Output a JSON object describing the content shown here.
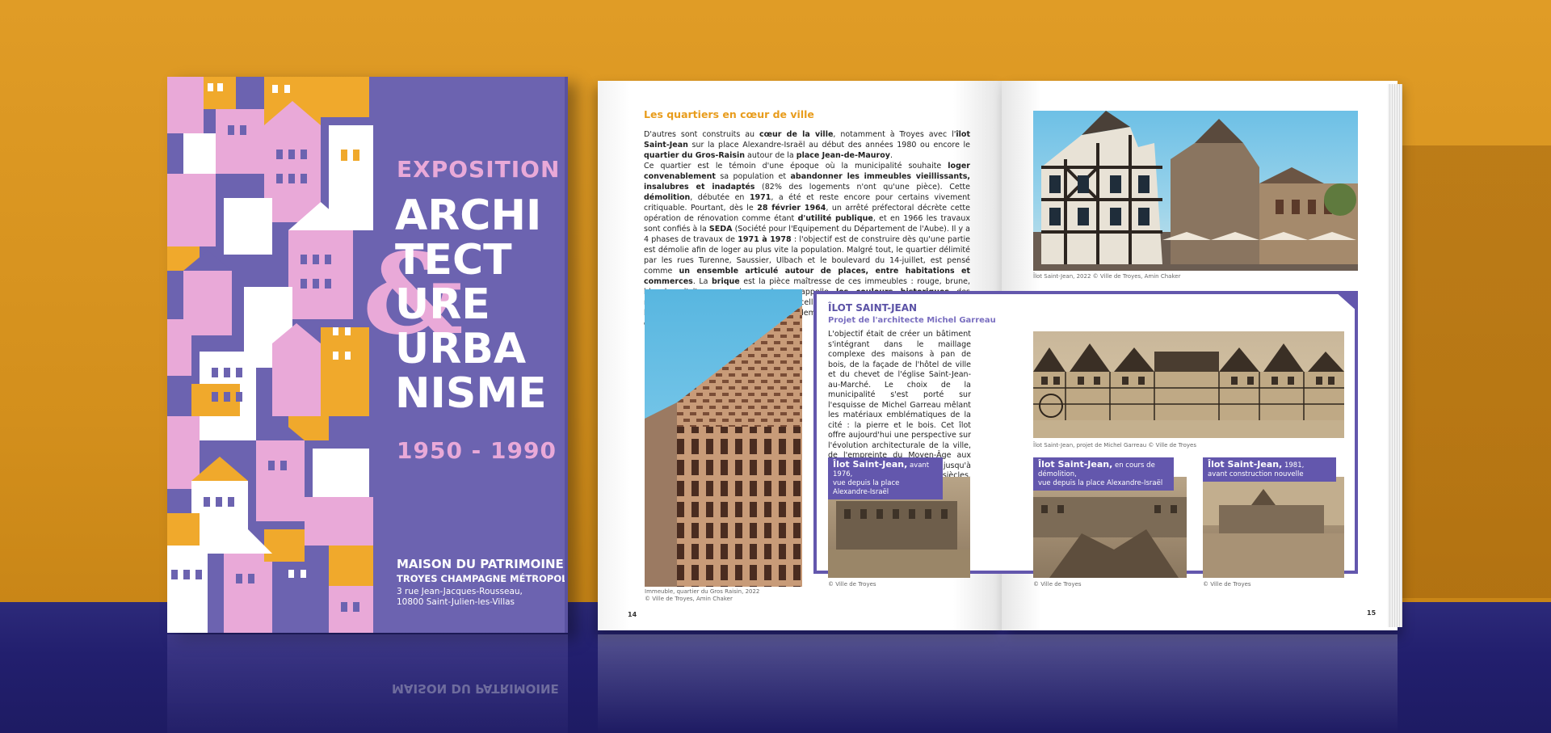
{
  "cover": {
    "exposition": "EXPOSITION",
    "title_lines": [
      "ARCHI",
      "TECT",
      "URE",
      "URBA",
      "NISME"
    ],
    "ampersand": "&",
    "years": "1950 - 1990",
    "publisher": "MAISON DU PATRIMOINE",
    "publisher_sub": "TROYES CHAMPAGNE MÉTROPOLE",
    "address_line1": "3 rue Jean-Jacques-Rousseau,",
    "address_line2": "10800 Saint-Julien-les-Villas",
    "colors": {
      "purple": "#6c63b0",
      "pink": "#e9a9d8",
      "orange": "#f0a92c",
      "white": "#ffffff"
    }
  },
  "left_page": {
    "section_title": "Les quartiers en cœur de ville",
    "photo_caption_line1": "Immeuble, quartier du Gros Raisin, 2022",
    "photo_caption_line2": "© Ville de Troyes, Amin Chaker",
    "page_number": "14"
  },
  "right_page": {
    "photo_caption": "Îlot Saint-Jean, 2022 © Ville de Troyes, Amin Chaker",
    "box_title": "ÎLOT SAINT-JEAN",
    "box_subtitle": "Projet de l'architecte Michel Garreau",
    "box_text": "L'objectif était de créer un bâtiment s'intégrant dans le maillage complexe des maisons à pan de bois, de la façade de l'hôtel de ville et du chevet de l'église Saint-Jean-au-Marché. Le choix de la municipalité s'est porté sur l'esquisse de Michel Garreau mêlant les matériaux emblématiques de la cité : la pierre et le bois. Cet îlot offre aujourd'hui une perspective sur l'évolution architecturale de la ville, de l'empreinte du Moyen-Âge aux restaurations successives, jusqu'à des créations des XXᵉ et XXIᵉ siècles.",
    "sketch_caption": "Îlot Saint-Jean, projet de Michel Garreau © Ville de Troyes",
    "photos": [
      {
        "title": "Îlot Saint-Jean,",
        "rest1": " avant 1976,",
        "rest2": "vue depuis la place Alexandre-Israël",
        "caption": "© Ville de Troyes"
      },
      {
        "title": "Îlot Saint-Jean,",
        "rest1": " en cours de démolition,",
        "rest2": "vue depuis la place Alexandre-Israël",
        "caption": "© Ville de Troyes"
      },
      {
        "title": "Îlot Saint-Jean,",
        "rest1": " 1981,",
        "rest2": "avant construction nouvelle",
        "caption": "© Ville de Troyes"
      }
    ],
    "page_number": "15",
    "accent_color": "#6357ad"
  }
}
